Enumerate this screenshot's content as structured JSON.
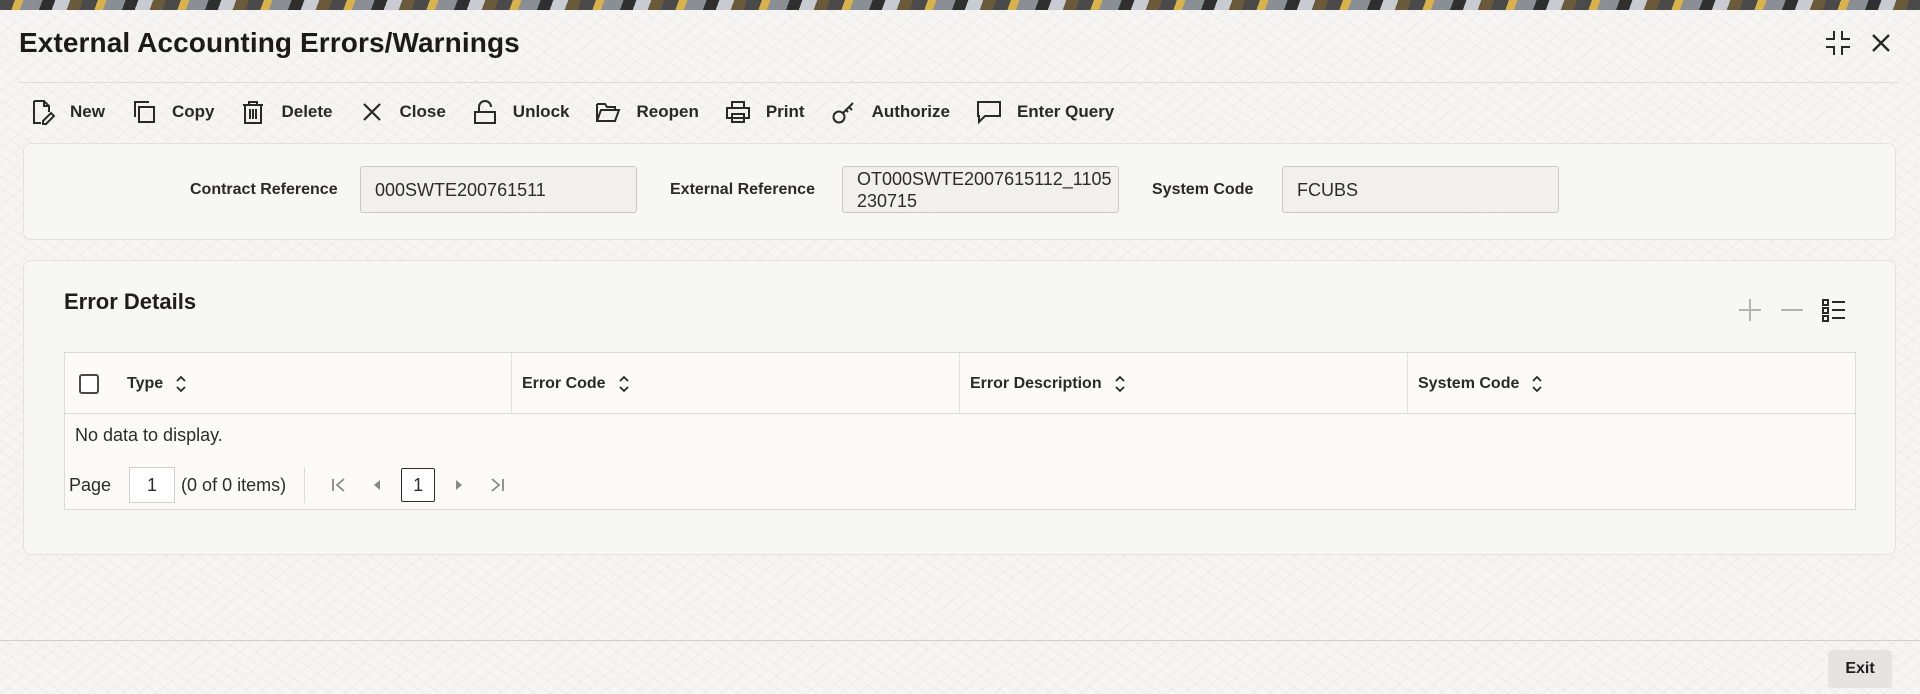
{
  "window": {
    "title": "External Accounting Errors/Warnings"
  },
  "toolbar": {
    "items": [
      {
        "label": "New",
        "icon": "new-document-icon"
      },
      {
        "label": "Copy",
        "icon": "copy-icon"
      },
      {
        "label": "Delete",
        "icon": "delete-icon"
      },
      {
        "label": "Close",
        "icon": "close-x-icon"
      },
      {
        "label": "Unlock",
        "icon": "unlock-icon"
      },
      {
        "label": "Reopen",
        "icon": "folder-open-icon"
      },
      {
        "label": "Print",
        "icon": "print-icon"
      },
      {
        "label": "Authorize",
        "icon": "key-icon"
      },
      {
        "label": "Enter Query",
        "icon": "chat-icon"
      }
    ]
  },
  "header": {
    "contract_reference_label": "Contract Reference",
    "contract_reference_value": "000SWTE200761511",
    "external_reference_label": "External Reference",
    "external_reference_value_line1": "OT000SWTE2007615112_1105",
    "external_reference_value_line2": "230715",
    "system_code_label": "System Code",
    "system_code_value": "FCUBS"
  },
  "error_details": {
    "title": "Error Details",
    "columns": [
      "Type",
      "Error Code",
      "Error Description",
      "System Code"
    ],
    "rows": [],
    "empty_text": "No data to display.",
    "pager": {
      "page_label": "Page",
      "page_value": "1",
      "items_text": "(0 of 0 items)",
      "current_page": "1"
    }
  },
  "footer": {
    "exit_label": "Exit"
  },
  "colors": {
    "background": "#f6f5f3",
    "panel": "#f7f6f4",
    "text": "#161513"
  }
}
